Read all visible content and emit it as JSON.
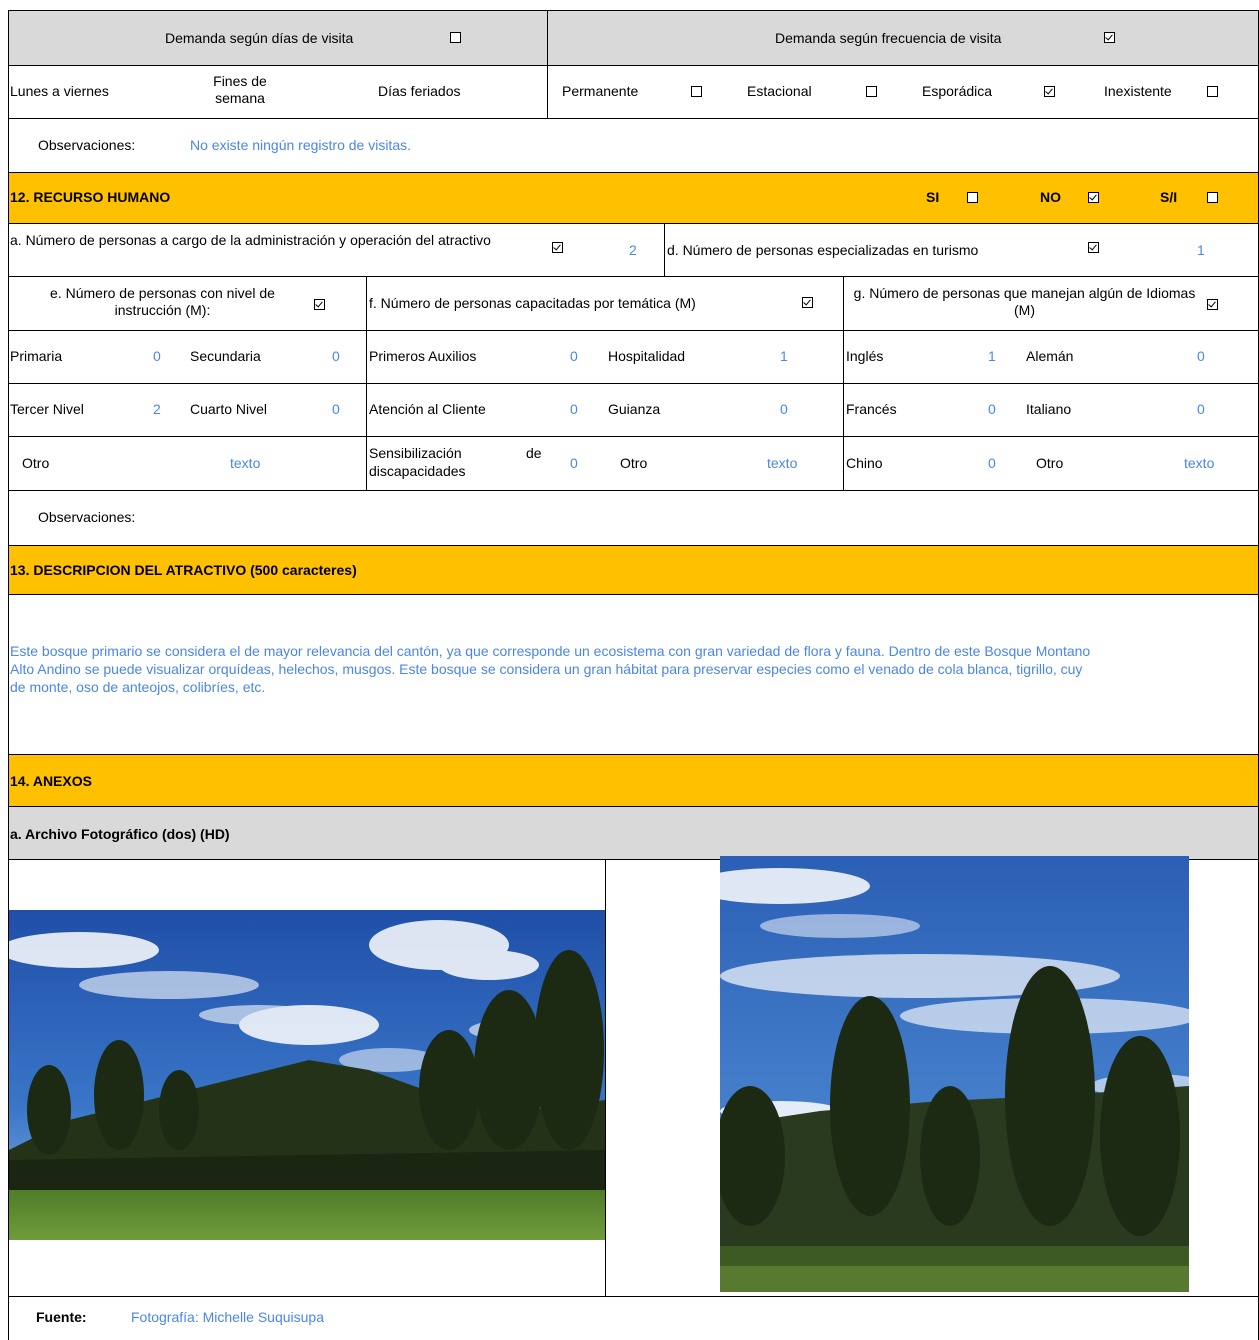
{
  "demand": {
    "days_label": "Demanda según  días de visita",
    "days_checked": false,
    "frequency_label": "Demanda según frecuencia de visita",
    "frequency_checked": true,
    "weekdays": "Lunes a viernes",
    "weekends": "Fines de semana",
    "holidays": "Días feriados",
    "permanent": "Permanente",
    "permanent_checked": false,
    "seasonal": "Estacional",
    "seasonal_checked": false,
    "sporadic": "Esporádica",
    "sporadic_checked": true,
    "nonexistent": "Inexistente",
    "nonexistent_checked": false,
    "obs_label": "Observaciones:",
    "obs_value": "No existe ningún registro de visitas."
  },
  "human": {
    "title": "12. RECURSO HUMANO",
    "si": "SI",
    "si_checked": false,
    "no": "NO",
    "no_checked": true,
    "si_n": "S/I",
    "si_n_checked": false,
    "a_label": "a. Número de personas a cargo de la administración y operación del atractivo",
    "a_checked": true,
    "a_value": "2",
    "d_label": "d. Número de personas especializadas en turismo",
    "d_checked": true,
    "d_value": "1",
    "e_label": "e. Número de personas con nivel de instrucción (M):",
    "e_checked": true,
    "f_label": "f. Número de personas capacitadas por temática (M)",
    "f_checked": true,
    "g_label": "g. Número de personas que manejan algún de Idiomas (M)",
    "g_checked": true,
    "primaria": "Primaria",
    "primaria_v": "0",
    "secundaria": "Secundaria",
    "secundaria_v": "0",
    "tercer": "Tercer Nivel",
    "tercer_v": "2",
    "cuarto": "Cuarto Nivel",
    "cuarto_v": "0",
    "otro_e": "Otro",
    "otro_e_v": "texto",
    "auxilios": "Primeros Auxilios",
    "auxilios_v": "0",
    "hospitalidad": "Hospitalidad",
    "hospitalidad_v": "1",
    "atencion": "Atención al Cliente",
    "atencion_v": "0",
    "guianza": "Guianza",
    "guianza_v": "0",
    "sensib_a": "Sensibilización",
    "sensib_b": "de",
    "sensib_c": "discapacidades",
    "sensib_v": "0",
    "otro_f": "Otro",
    "otro_f_v": "texto",
    "ingles": "Inglés",
    "ingles_v": "1",
    "aleman": "Alemán",
    "aleman_v": "0",
    "frances": "Francés",
    "frances_v": "0",
    "italiano": "Italiano",
    "italiano_v": "0",
    "chino": "Chino",
    "chino_v": "0",
    "otro_g": "Otro",
    "otro_g_v": "texto",
    "obs_label": "Observaciones:"
  },
  "description": {
    "title": "13. DESCRIPCION DEL ATRACTIVO (500 caracteres)",
    "line1": "Este bosque primario se considera el de mayor relevancia del cantón, ya que corresponde un ecosistema con gran variedad de flora y fauna. Dentro de este Bosque Montano",
    "line2": "Alto Andino se puede visualizar orquídeas, helechos, musgos. Este bosque se considera un gran hábitat para preservar especies como el venado de cola blanca, tigrillo, cuy",
    "line3": "de monte, oso de anteojos, colibríes, etc."
  },
  "annex": {
    "title": "14. ANEXOS",
    "photos_label": "a. Archivo Fotográfico (dos) (HD)",
    "source_label": "Fuente:",
    "source_value": "Fotografía: Michelle Suquisupa"
  }
}
